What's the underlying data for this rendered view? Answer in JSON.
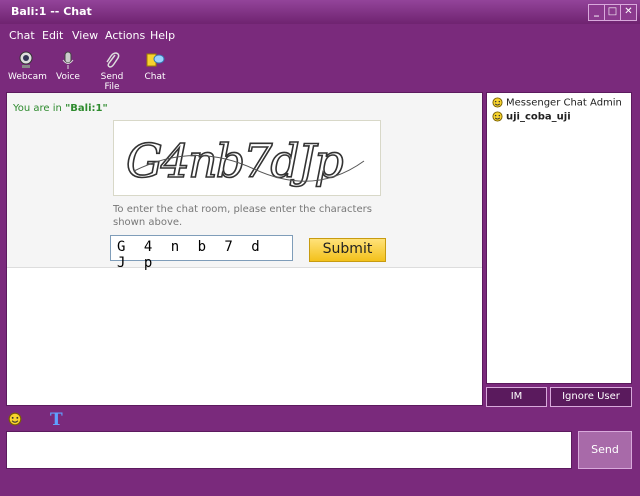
{
  "window": {
    "title": "Bali:1 -- Chat"
  },
  "menu": [
    {
      "label": "Chat"
    },
    {
      "label": "Edit"
    },
    {
      "label": "View"
    },
    {
      "label": "Actions"
    },
    {
      "label": "Help"
    }
  ],
  "toolbar": [
    {
      "label": "Webcam",
      "icon": "webcam-icon"
    },
    {
      "label": "Voice",
      "icon": "microphone-icon"
    },
    {
      "label": "Send File",
      "icon": "paperclip-icon"
    },
    {
      "label": "Chat",
      "icon": "chat-icon"
    }
  ],
  "chat": {
    "room_prefix": "You are in ",
    "room_name": "\"Bali:1\"",
    "captcha_text": "G4nb7dJp",
    "instructions": "To enter the chat room, please enter the characters shown above.",
    "captcha_value": "G 4 n b 7 d J p",
    "submit_label": "Submit"
  },
  "users": [
    {
      "name": "Messenger Chat Admin",
      "bold": false
    },
    {
      "name": "uji_coba_uji",
      "bold": true
    }
  ],
  "user_buttons": {
    "im": "IM",
    "ignore": "Ignore User"
  },
  "format": {
    "text_icon": "T"
  },
  "message": {
    "send_label": "Send",
    "value": ""
  },
  "colors": {
    "frame": "#7a2a7c",
    "room_name": "#2e8b2e",
    "submit": "#f3c11b"
  }
}
